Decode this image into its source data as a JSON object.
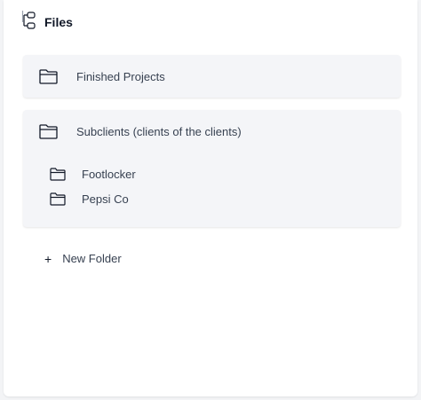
{
  "header": {
    "title": "Files",
    "icon": "file-tree-icon"
  },
  "folders": [
    {
      "label": "Finished Projects",
      "icon": "folder-icon"
    },
    {
      "label": "Subclients (clients of the clients)",
      "icon": "folder-icon",
      "children": [
        {
          "label": "Footlocker",
          "icon": "folder-icon"
        },
        {
          "label": "Pepsi Co",
          "icon": "folder-icon"
        }
      ]
    }
  ],
  "actions": {
    "new_folder_label": "New Folder",
    "new_folder_icon": "plus-icon"
  },
  "colors": {
    "card_bg": "#f4f5f8",
    "page_bg": "#f3f4f6",
    "text": "#374151"
  }
}
